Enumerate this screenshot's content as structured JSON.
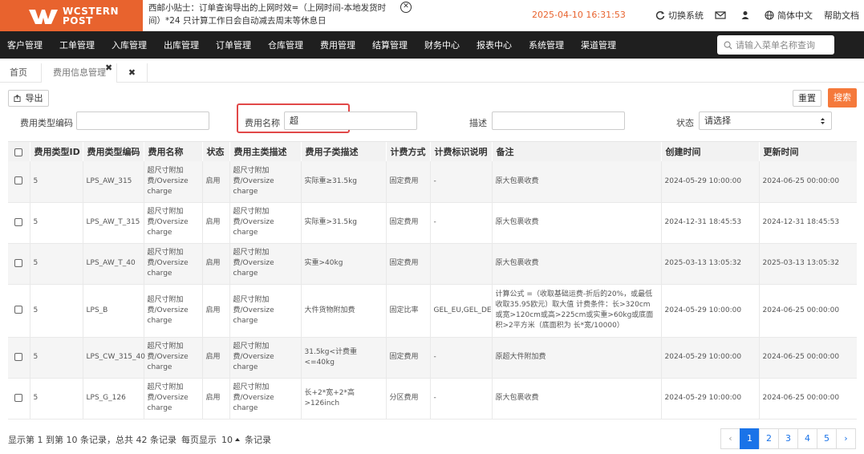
{
  "app": {
    "logo_line1": "WCSTERN",
    "logo_line2": "POST"
  },
  "notice": {
    "text_line1": "西邮小贴士：订单查询导出的上网时效=（上网时间-本地发货时",
    "text_line2": "间）*24 只计算工作日会自动减去周末等休息日"
  },
  "header": {
    "datetime": "2025-04-10 16:31:53",
    "switch_system": "切换系统",
    "language": "简体中文",
    "help": "帮助文档"
  },
  "nav": {
    "items": [
      "客户管理",
      "工单管理",
      "入库管理",
      "出库管理",
      "订单管理",
      "仓库管理",
      "费用管理",
      "结算管理",
      "财务中心",
      "报表中心",
      "系统管理",
      "渠道管理"
    ],
    "search_placeholder": "请输入菜单名称查询"
  },
  "tabs": {
    "home": "首页",
    "fee_info": "费用信息管理"
  },
  "toolbar": {
    "export": "导出",
    "reset": "重置",
    "search": "搜索"
  },
  "filters": {
    "type_code_label": "费用类型编码",
    "type_code_value": "",
    "fee_name_label": "费用名称",
    "fee_name_value": "超",
    "desc_label": "描述",
    "desc_value": "",
    "status_label": "状态",
    "status_value": "请选择"
  },
  "table": {
    "headers": [
      "费用类型ID",
      "费用类型编码",
      "费用名称",
      "状态",
      "费用主类描述",
      "费用子类描述",
      "计费方式",
      "计费标识说明",
      "备注",
      "创建时间",
      "更新时间"
    ],
    "rows": [
      [
        "5",
        "LPS_AW_315",
        "超尺寸附加费/Oversize charge",
        "启用",
        "超尺寸附加费/Oversize charge",
        "实际重≥31.5kg",
        "固定费用",
        "-",
        "原大包裹收费",
        "2024-05-29 10:00:00",
        "2024-06-25 00:00:00"
      ],
      [
        "5",
        "LPS_AW_T_315",
        "超尺寸附加费/Oversize charge",
        "启用",
        "超尺寸附加费/Oversize charge",
        "实际重>31.5kg",
        "固定费用",
        "-",
        "原大包裹收费",
        "2024-12-31 18:45:53",
        "2024-12-31 18:45:53"
      ],
      [
        "5",
        "LPS_AW_T_40",
        "超尺寸附加费/Oversize charge",
        "启用",
        "超尺寸附加费/Oversize charge",
        "实重>40kg",
        "固定费用",
        "",
        "原大包裹收费",
        "2025-03-13 13:05:32",
        "2025-03-13 13:05:32"
      ],
      [
        "5",
        "LPS_B",
        "超尺寸附加费/Oversize charge",
        "启用",
        "超尺寸附加费/Oversize charge",
        "大件货物附加费",
        "固定比率",
        "GEL_EU,GEL_DE",
        "计算公式 =（收取基础运费-折后的20%，或最低收取35.95欧元）取大值 计费条件：长>320cm或宽>120cm或高>225cm或实重>60kg或底面积>2平方米（底面积为 长*宽/10000）",
        "2024-05-29 10:00:00",
        "2024-06-25 00:00:00"
      ],
      [
        "5",
        "LPS_CW_315_40",
        "超尺寸附加费/Oversize charge",
        "启用",
        "超尺寸附加费/Oversize charge",
        "31.5kg<计费重<=40kg",
        "固定费用",
        "-",
        "原超大件附加费",
        "2024-05-29 10:00:00",
        "2024-06-25 00:00:00"
      ],
      [
        "5",
        "LPS_G_126",
        "超尺寸附加费/Oversize charge",
        "启用",
        "超尺寸附加费/Oversize charge",
        "长+2*宽+2*高>126inch",
        "分区费用",
        "-",
        "原大包裹收费",
        "2024-05-29 10:00:00",
        "2024-06-25 00:00:00"
      ]
    ]
  },
  "footer": {
    "range_text": "显示第 1 到第 10 条记录，总共 42 条记录",
    "per_page_label": "每页显示",
    "per_page_value": "10",
    "records_suffix": "条记录",
    "pages": [
      "‹",
      "1",
      "2",
      "3",
      "4",
      "5",
      "›"
    ],
    "current_page": "1"
  },
  "colors": {
    "brand": "#e8632e",
    "nav_bg": "#1f1f1f",
    "primary": "#1a73e8",
    "search_btn": "#f5793b",
    "highlight": "#e14848"
  }
}
